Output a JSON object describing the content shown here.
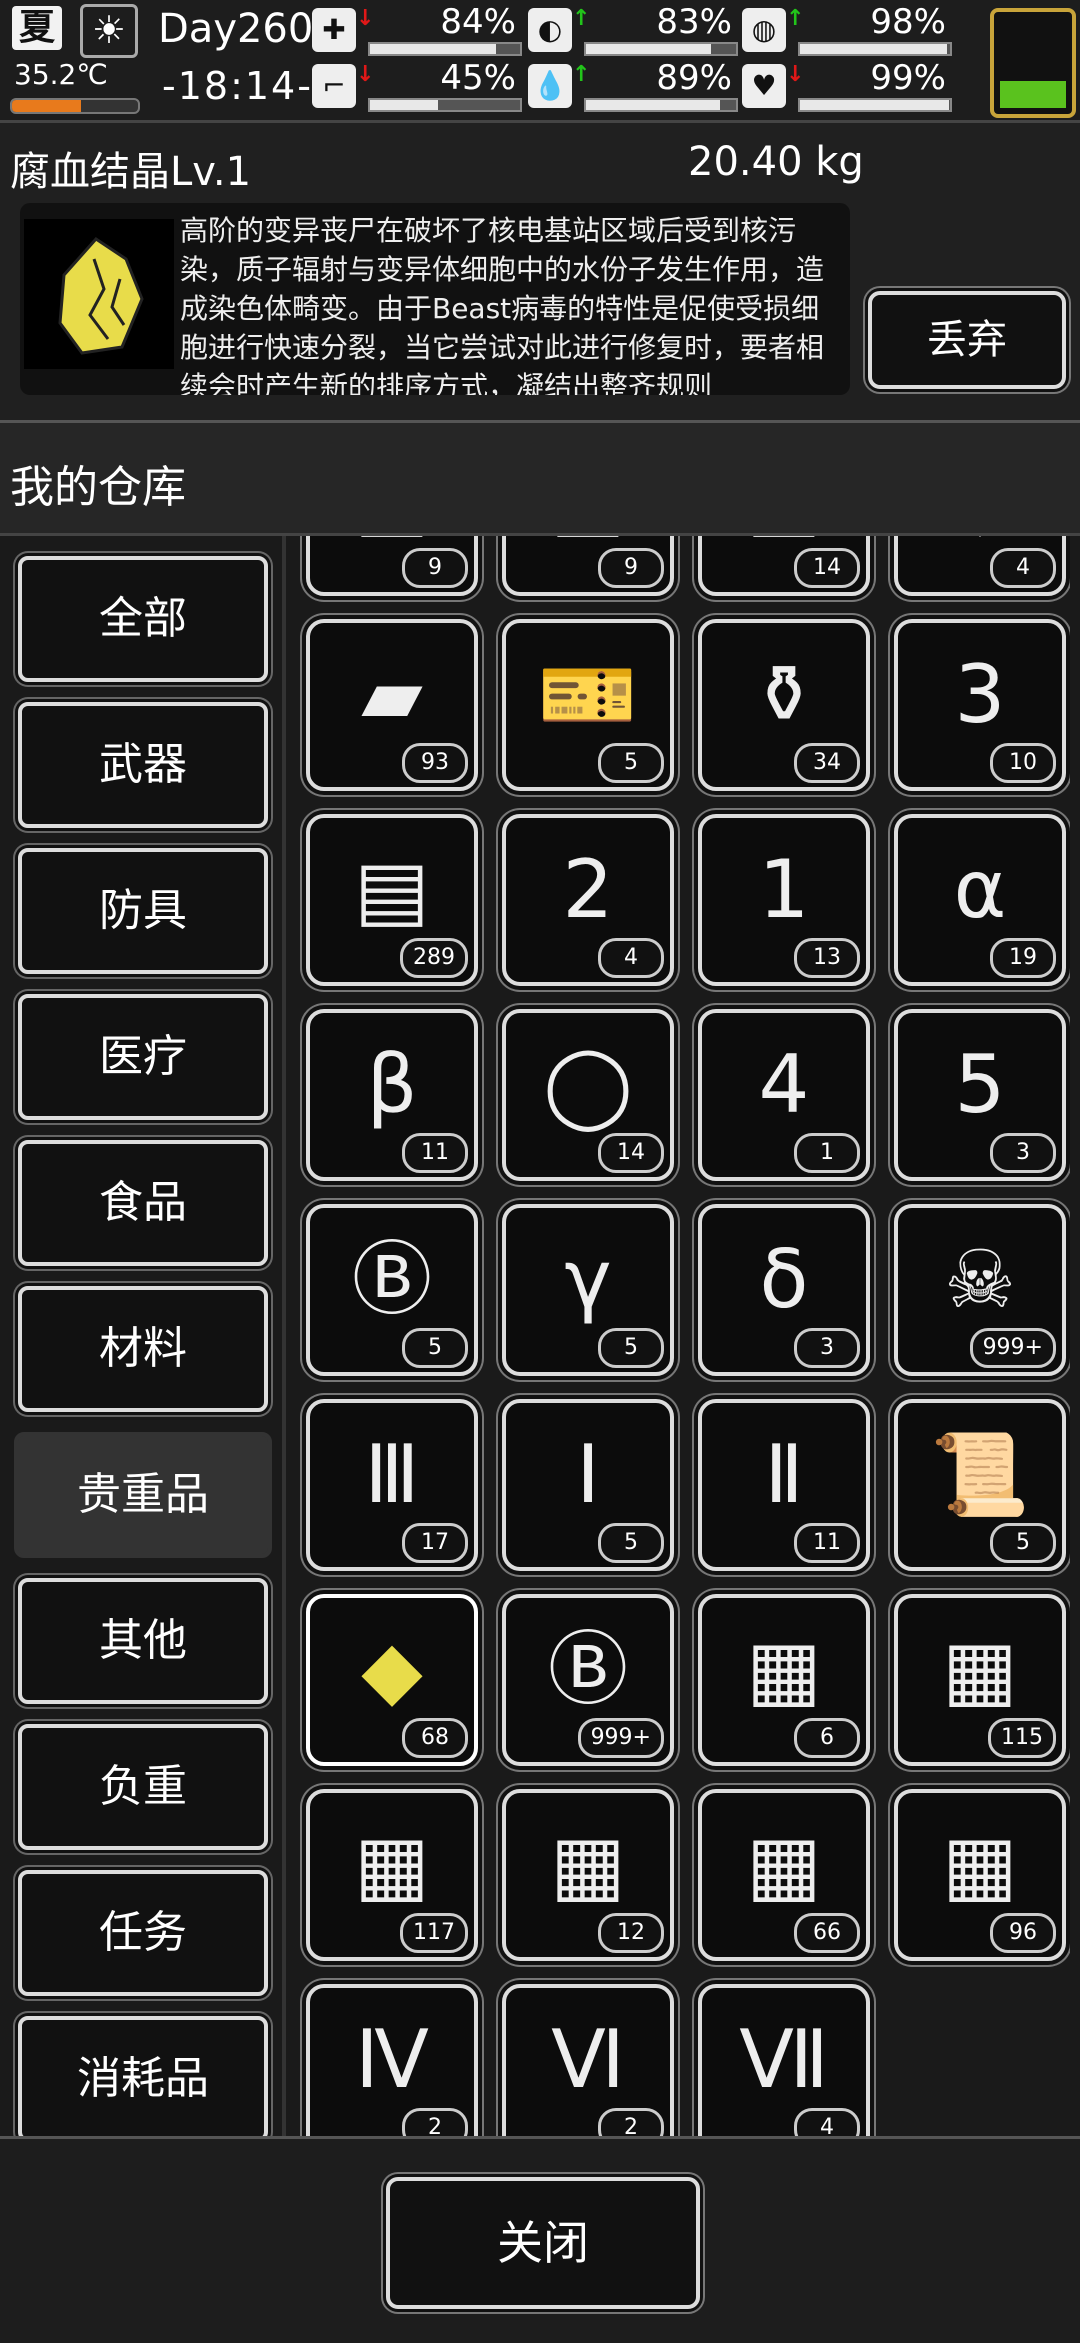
{
  "status": {
    "season": "夏",
    "weather_icon": "sun-icon",
    "temperature": "35.2℃",
    "temperature_level": 0.55,
    "day": "Day260",
    "time": "-18:14-",
    "stats": [
      {
        "name": "health-kit",
        "icon": "✚",
        "trend": "down",
        "value": "84%",
        "level": 0.84
      },
      {
        "name": "stomach",
        "icon": "◐",
        "trend": "up",
        "value": "83%",
        "level": 0.83
      },
      {
        "name": "pill",
        "icon": "◍",
        "trend": "up",
        "value": "98%",
        "level": 0.98
      },
      {
        "name": "boot",
        "icon": "⌐",
        "trend": "down",
        "value": "45%",
        "level": 0.45
      },
      {
        "name": "water",
        "icon": "💧",
        "trend": "up",
        "value": "89%",
        "level": 0.89
      },
      {
        "name": "heart",
        "icon": "♥",
        "trend": "down",
        "value": "99%",
        "level": 0.99
      }
    ],
    "battery_level": 0.3
  },
  "detail": {
    "name": "腐血结晶Lv.1",
    "weight": "20.40 kg",
    "description": "高阶的变异丧尸在破坏了核电基站区域后受到核污染，质子辐射与变异体细胞中的水份子发生作用，造成染色体畸变。由于Beast病毒的特性是促使受损细胞进行快速分裂，当它尝试对此进行修复时，要者相续会时产生新的排序方式，凝结出整齐规则",
    "discard_label": "丢弃"
  },
  "warehouse": {
    "title": "我的仓库",
    "categories": [
      "全部",
      "武器",
      "防具",
      "医疗",
      "食品",
      "材料",
      "贵重品",
      "其他",
      "负重",
      "任务",
      "消耗品"
    ],
    "active_category": 6
  },
  "items": [
    {
      "icon": "item-icon",
      "glyph": "▣",
      "count": "9"
    },
    {
      "icon": "item-icon",
      "glyph": "▣",
      "count": "9"
    },
    {
      "icon": "item-icon",
      "glyph": "▣",
      "count": "14"
    },
    {
      "icon": "item-icon",
      "glyph": "◆",
      "count": "4"
    },
    {
      "icon": "gold-bars-icon",
      "glyph": "▰",
      "count": "93"
    },
    {
      "icon": "id-ticket-icon",
      "glyph": "🎫",
      "count": "5"
    },
    {
      "icon": "vase-icon",
      "glyph": "⚱",
      "count": "34"
    },
    {
      "icon": "blueprint-lv3-icon",
      "glyph": "3",
      "count": "10"
    },
    {
      "icon": "cash-stack-icon",
      "glyph": "▤",
      "count": "289"
    },
    {
      "icon": "blueprint-lv2-icon",
      "glyph": "2",
      "count": "4"
    },
    {
      "icon": "blueprint-lv1-icon",
      "glyph": "1",
      "count": "13"
    },
    {
      "icon": "test-tube-alpha-icon",
      "glyph": "α",
      "count": "19"
    },
    {
      "icon": "test-tube-beta-icon",
      "glyph": "β",
      "count": "11"
    },
    {
      "icon": "ring-icon",
      "glyph": "◯",
      "count": "14"
    },
    {
      "icon": "blueprint-lv4-icon",
      "glyph": "4",
      "count": "1"
    },
    {
      "icon": "blueprint-lv5-icon",
      "glyph": "5",
      "count": "3"
    },
    {
      "icon": "b-token-paper-icon",
      "glyph": "Ⓑ",
      "count": "5"
    },
    {
      "icon": "test-tube-gamma-icon",
      "glyph": "γ",
      "count": "5"
    },
    {
      "icon": "test-tube-delta-icon",
      "glyph": "δ",
      "count": "3"
    },
    {
      "icon": "zombie-card-icon",
      "glyph": "☠",
      "count": "999+"
    },
    {
      "icon": "test-tube-iii-icon",
      "glyph": "Ⅲ",
      "count": "17"
    },
    {
      "icon": "test-tube-i-icon",
      "glyph": "Ⅰ",
      "count": "5"
    },
    {
      "icon": "test-tube-ii-icon",
      "glyph": "Ⅱ",
      "count": "11"
    },
    {
      "icon": "scroll-icon",
      "glyph": "📜",
      "count": "5"
    },
    {
      "icon": "rot-blood-crystal-icon",
      "glyph": "◆",
      "count": "68",
      "selected": true
    },
    {
      "icon": "b-coin-icon",
      "glyph": "Ⓑ",
      "count": "999+"
    },
    {
      "icon": "chest-dollar-icon",
      "glyph": "▦",
      "count": "6"
    },
    {
      "icon": "chest-i-icon",
      "glyph": "▦",
      "count": "115"
    },
    {
      "icon": "chest-ii-icon",
      "glyph": "▦",
      "count": "117"
    },
    {
      "icon": "chest-v-icon",
      "glyph": "▦",
      "count": "12"
    },
    {
      "icon": "chest-iv-icon",
      "glyph": "▦",
      "count": "66"
    },
    {
      "icon": "chest-iii-icon",
      "glyph": "▦",
      "count": "96"
    },
    {
      "icon": "test-tube-iv-icon",
      "glyph": "Ⅳ",
      "count": "2"
    },
    {
      "icon": "test-tube-vi-icon",
      "glyph": "Ⅵ",
      "count": "2"
    },
    {
      "icon": "test-tube-vii-icon",
      "glyph": "Ⅶ",
      "count": "4"
    }
  ],
  "close_label": "关闭",
  "colors": {
    "accent": "#5ac21e",
    "crystal": "#e8dc4a",
    "temp": "#e87a1c",
    "trend_up": "#22c41a",
    "trend_down": "#e01818"
  }
}
